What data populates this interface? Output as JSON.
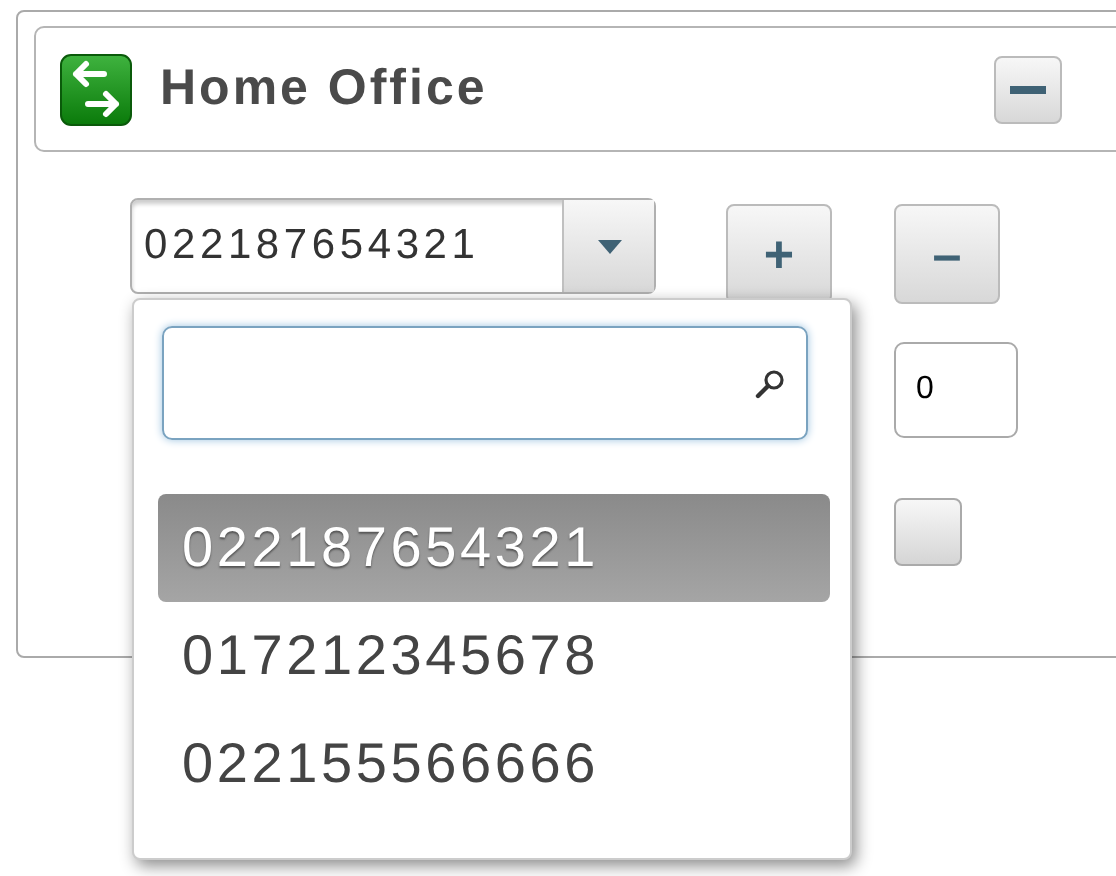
{
  "panel": {
    "title": "Home Office"
  },
  "combo": {
    "value": "022187654321"
  },
  "dropdown": {
    "options": [
      {
        "label": "022187654321",
        "selected": true
      },
      {
        "label": "017212345678",
        "selected": false
      },
      {
        "label": "022155566666",
        "selected": false
      }
    ]
  },
  "buttons": [
    {
      "kind": "plus",
      "label": "+"
    },
    {
      "kind": "minus",
      "label": "–"
    }
  ],
  "number_field": {
    "value": "0"
  },
  "checkbox": {
    "checked": false
  }
}
